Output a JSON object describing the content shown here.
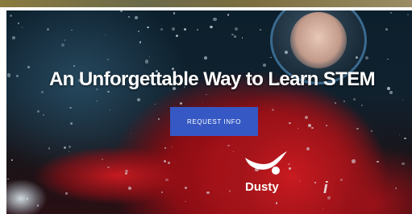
{
  "hero": {
    "headline": "An Unforgettable Way to Learn STEM",
    "cta_label": "REQUEST INFO",
    "logo_text": "Dusty",
    "sleeve_mark": "i"
  },
  "colors": {
    "cta_background": "#3558c4",
    "suit_red": "#c81a20",
    "background_dark": "#0c1f2c",
    "headline_text": "#ffffff"
  },
  "icons": {
    "logo": "flying-figure-logo-icon"
  }
}
